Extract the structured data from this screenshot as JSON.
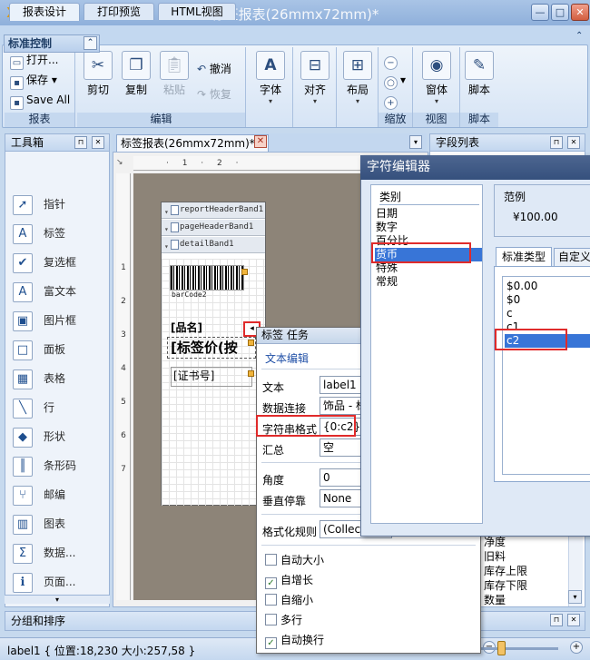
{
  "window": {
    "title": "标签报表(26mmx72mm)*"
  },
  "ribbon_tabs": [
    "报表设计",
    "打印预览",
    "HTML视图"
  ],
  "ribbon": {
    "report_group": {
      "label": "报表",
      "open": "打开...",
      "save": "保存",
      "save_all": "Save All"
    },
    "edit_group": {
      "label": "编辑",
      "cut": "剪切",
      "copy": "复制",
      "paste": "粘贴",
      "undo": "撤消",
      "redo": "恢复"
    },
    "font": "字体",
    "align": "对齐",
    "layout": "布局",
    "zoom_group": {
      "label": "缩放"
    },
    "view_group": {
      "label": "视图",
      "window": "窗体"
    },
    "script_group": {
      "label": "脚本",
      "script": "脚本"
    }
  },
  "toolbox": {
    "title": "工具箱",
    "section": "标准控制",
    "items": [
      {
        "label": "指针",
        "icon": "pointer-icon",
        "glyph": "➚"
      },
      {
        "label": "标签",
        "icon": "label-icon",
        "glyph": "A"
      },
      {
        "label": "复选框",
        "icon": "checkbox-icon",
        "glyph": "✔"
      },
      {
        "label": "富文本",
        "icon": "richtext-icon",
        "glyph": "A"
      },
      {
        "label": "图片框",
        "icon": "picture-icon",
        "glyph": "▣"
      },
      {
        "label": "面板",
        "icon": "panel-icon",
        "glyph": "□"
      },
      {
        "label": "表格",
        "icon": "table-icon",
        "glyph": "▦"
      },
      {
        "label": "行",
        "icon": "line-icon",
        "glyph": "╲"
      },
      {
        "label": "形状",
        "icon": "shape-icon",
        "glyph": "◆"
      },
      {
        "label": "条形码",
        "icon": "barcode-icon",
        "glyph": "║"
      },
      {
        "label": "邮编",
        "icon": "zipcode-icon",
        "glyph": "⑂"
      },
      {
        "label": "图表",
        "icon": "chart-icon",
        "glyph": "▥"
      },
      {
        "label": "数据...",
        "icon": "sum-icon",
        "glyph": "Σ"
      },
      {
        "label": "页面...",
        "icon": "pageinfo-icon",
        "glyph": "ℹ"
      }
    ]
  },
  "document": {
    "tab_title": "标签报表(26mmx72mm)*",
    "ruler_marks": "· 1 · 2 ·",
    "vruler": [
      "1",
      "2",
      "3",
      "4",
      "5",
      "6",
      "7"
    ],
    "bands": [
      "reportHeaderBand1",
      "pageHeaderBand1",
      "detailBand1"
    ],
    "barcode_label": "barCode2",
    "label_pinming": "[品名]",
    "label_price": "[标签价(按",
    "label_cert": "[证书号]"
  },
  "field_list": {
    "title": "字段列表",
    "items": [
      "净度",
      "旧料",
      "库存上限",
      "库存下限",
      "数量"
    ]
  },
  "task_popup": {
    "title": "标签 任务",
    "edit_link": "文本编辑",
    "props": {
      "text_label": "文本",
      "text_value": "label1",
      "binding_label": "数据连接",
      "binding_value": "饰品 - 标",
      "format_label": "字符串格式",
      "format_value": "{0:c2}",
      "summary_label": "汇总",
      "summary_value": "空",
      "angle_label": "角度",
      "angle_value": "0",
      "vdock_label": "垂直停靠",
      "vdock_value": "None",
      "rules_label": "格式化规则",
      "rules_value": "(Collect"
    },
    "checks": [
      {
        "label": "自动大小",
        "checked": false
      },
      {
        "label": "自增长",
        "checked": true
      },
      {
        "label": "自缩小",
        "checked": false
      },
      {
        "label": "多行",
        "checked": false
      },
      {
        "label": "自动换行",
        "checked": true
      }
    ]
  },
  "char_editor": {
    "title": "字符编辑器",
    "category_title": "类别",
    "categories": [
      "日期",
      "数字",
      "百分比",
      "货币",
      "特殊",
      "常规"
    ],
    "selected_category": "货币",
    "sample_label": "范例",
    "sample_value": "¥100.00",
    "tab_standard": "标准类型",
    "tab_custom": "自定义",
    "formats": [
      "$0.00",
      "$0",
      "c",
      "c1",
      "c2"
    ],
    "selected_format": "c2"
  },
  "group_pane": {
    "title": "分组和排序"
  },
  "status": {
    "text": "label1 { 位置:18,230 大小:257,58 }"
  },
  "colors": {
    "accent": "#3875d7",
    "highlight": "#e02b2b"
  }
}
